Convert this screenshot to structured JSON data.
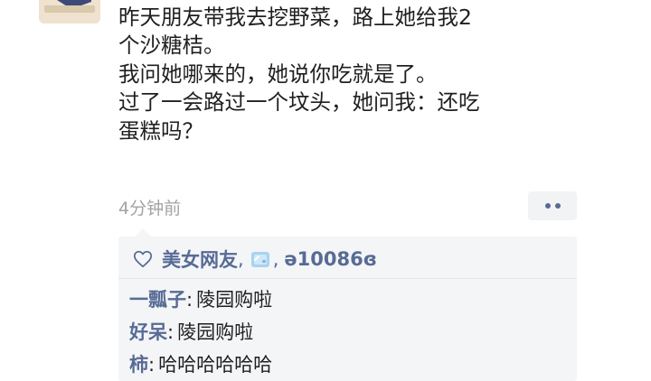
{
  "post": {
    "lines": [
      "昨天朋友带我去挖野菜，路上她给我2",
      "个沙糖桔。",
      "我问她哪来的，她说你吃就是了。",
      "过了一会路过一个坟头，她问我：还吃",
      "蛋糕吗？"
    ],
    "timestamp": "4分钟前"
  },
  "likes": {
    "icon": "heart-outline-icon",
    "first": "美女网友",
    "separator_1": ",",
    "emoji": "ice-cube-emoji",
    "separator_2": ",",
    "second": "ə10086ɞ"
  },
  "comments": [
    {
      "author": "一瓢子",
      "colon": ":",
      "text": "陵园购啦"
    },
    {
      "author": "好呆",
      "colon": ":",
      "text": "陵园购啦"
    },
    {
      "author": "柿",
      "colon": ":",
      "text": "哈哈哈哈哈哈"
    }
  ],
  "colors": {
    "link": "#576b95",
    "panel_bg": "#f4f5f7",
    "timestamp": "#a3a3a3",
    "text": "#1f1f1f"
  }
}
